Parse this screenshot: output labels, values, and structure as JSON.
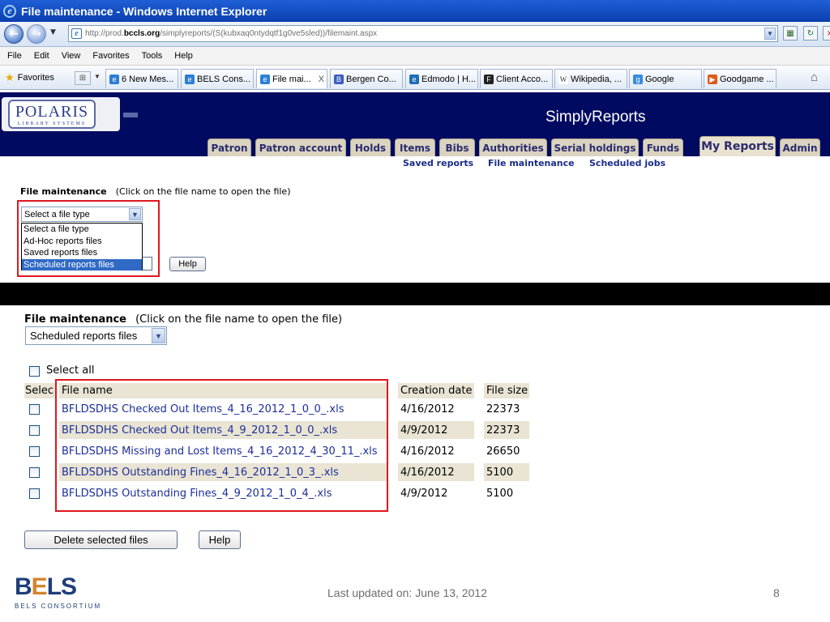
{
  "browser": {
    "title": "File maintenance - Windows Internet Explorer",
    "url_prefix": "http://prod.",
    "url_domain": "bccls.org",
    "url_path": "/simplyreports/(S(kubxaq0ntydqtf1g0ve5sled))/filemaint.aspx",
    "menu": [
      "File",
      "Edit",
      "View",
      "Favorites",
      "Tools",
      "Help"
    ],
    "favorites_label": "Favorites",
    "tabs": [
      {
        "label": "6 New Mes...",
        "icon": "ie-icon",
        "color": "#2d7fd4"
      },
      {
        "label": "BELS Cons...",
        "icon": "ie-icon",
        "color": "#2d7fd4"
      },
      {
        "label": "File mai...",
        "icon": "ie-icon",
        "color": "#2d7fd4",
        "active": true
      },
      {
        "label": "Bergen Co...",
        "icon": "bergen-icon",
        "color": "#3a5fc0"
      },
      {
        "label": "Edmodo | H...",
        "icon": "edmodo-icon",
        "color": "#1e6fb8"
      },
      {
        "label": "Client Acco...",
        "icon": "fax-icon",
        "color": "#222222"
      },
      {
        "label": "Wikipedia, ...",
        "icon": "wikipedia-icon",
        "color": "#444444"
      },
      {
        "label": "Google",
        "icon": "google-icon",
        "color": "#3a8be0"
      },
      {
        "label": "Goodgame ...",
        "icon": "goodgame-icon",
        "color": "#e05a1a"
      }
    ],
    "tab_close": "X"
  },
  "app": {
    "logo_main": "POLARIS",
    "logo_sub": "LIBRARY SYSTEMS",
    "title": "SimplyReports",
    "tabs": [
      "Patron",
      "Patron account",
      "Holds",
      "Items",
      "Bibs",
      "Authorities",
      "Serial holdings",
      "Funds",
      "My Reports",
      "Admin"
    ],
    "subnav": [
      "Saved reports",
      "File maintenance",
      "Scheduled jobs"
    ]
  },
  "upper": {
    "title": "File maintenance",
    "hint": "(Click on the file name to open the file)",
    "select_value": "Select a file type",
    "options": [
      "Select a file type",
      "Ad-Hoc reports files",
      "Saved reports files",
      "Scheduled reports files"
    ],
    "help_label": "Help"
  },
  "lower": {
    "title": "File maintenance",
    "hint": "(Click on the file name to open the file)",
    "select_value": "Scheduled reports files",
    "select_all": "Select all",
    "columns": [
      "Selec",
      "File name",
      "Creation date",
      "File size"
    ],
    "rows": [
      {
        "name": "BFLDSDHS Checked Out Items_4_16_2012_1_0_0_.xls",
        "date": "4/16/2012",
        "size": "22373"
      },
      {
        "name": "BFLDSDHS Checked Out Items_4_9_2012_1_0_0_.xls",
        "date": "4/9/2012",
        "size": "22373"
      },
      {
        "name": "BFLDSDHS Missing and Lost Items_4_16_2012_4_30_11_.xls",
        "date": "4/16/2012",
        "size": "26650"
      },
      {
        "name": "BFLDSDHS Outstanding Fines_4_16_2012_1_0_3_.xls",
        "date": "4/16/2012",
        "size": "5100"
      },
      {
        "name": "BFLDSDHS Outstanding Fines_4_9_2012_1_0_4_.xls",
        "date": "4/9/2012",
        "size": "5100"
      }
    ],
    "delete_label": "Delete selected files",
    "help_label": "Help"
  },
  "footer": {
    "logo_b": "B",
    "logo_e": "E",
    "logo_ls": "LS",
    "logo_sub": "BELS CONSORTIUM",
    "last_updated": "Last updated on: June 13, 2012",
    "slide_number": "8"
  }
}
